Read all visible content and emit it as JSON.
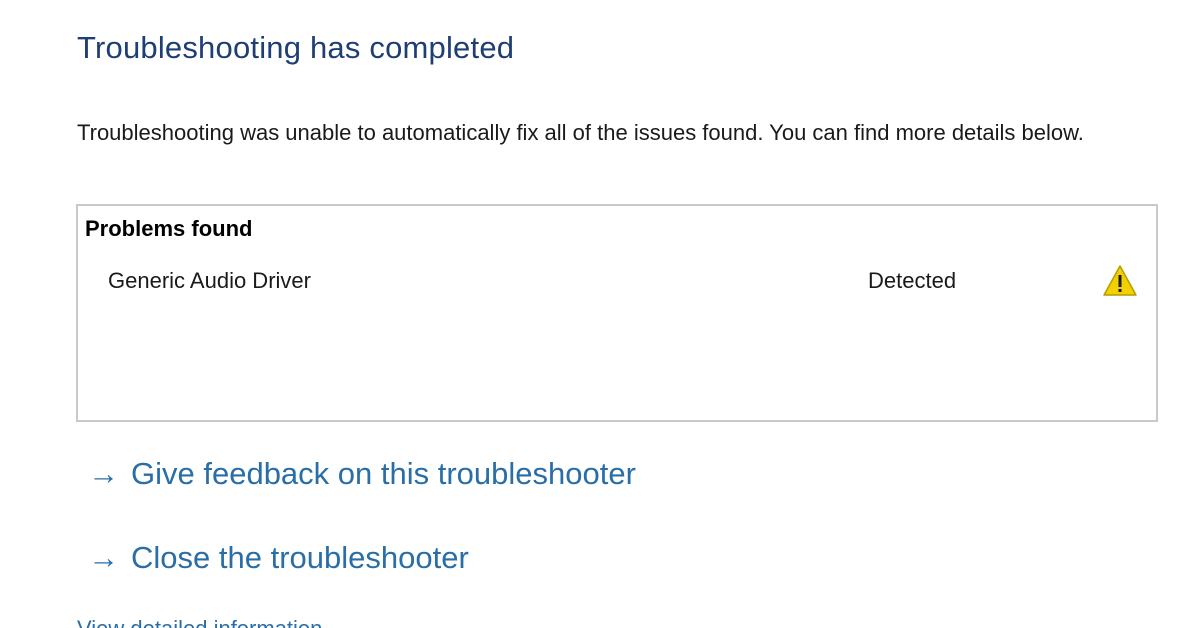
{
  "header": {
    "title": "Troubleshooting has completed"
  },
  "main": {
    "description": "Troubleshooting was unable to automatically fix all of the issues found. You can find more details below.",
    "problems": {
      "heading": "Problems found",
      "items": [
        {
          "name": "Generic Audio Driver",
          "status": "Detected",
          "icon": "warning-icon"
        }
      ]
    },
    "links": {
      "feedback": "Give feedback on this troubleshooter",
      "close": "Close the troubleshooter",
      "detailed": "View detailed information"
    }
  },
  "colors": {
    "title": "#1f3e74",
    "link": "#2a6ea8",
    "warning": "#f2d100"
  }
}
